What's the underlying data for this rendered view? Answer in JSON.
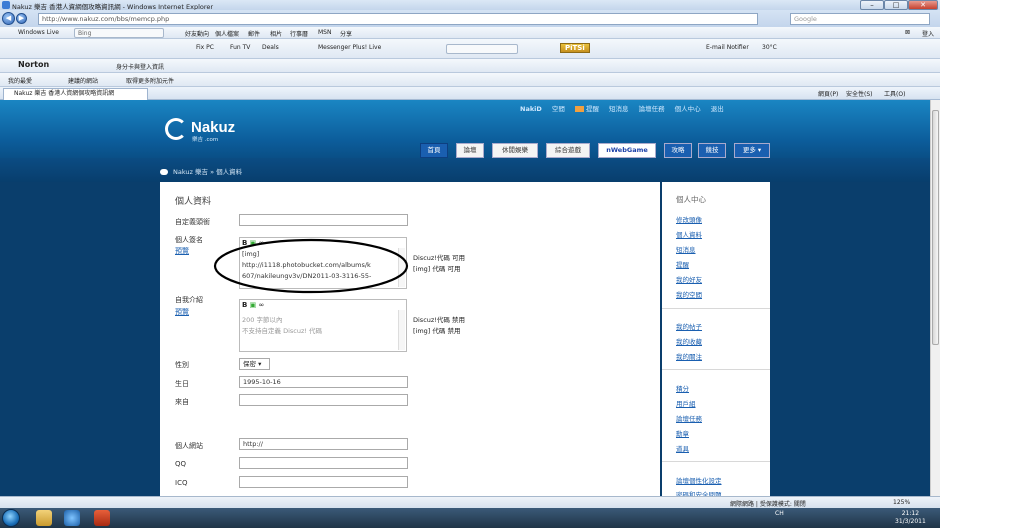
{
  "browser": {
    "title": "Nakuz 樂吉 香港人資網個攻略資訊網 - Windows Internet Explorer",
    "address": "http://www.nakuz.com/bbs/memcp.php",
    "search_provider": "Google",
    "windows_live": "Windows Live",
    "bing": "Bing",
    "toolbar1_items": [
      "好友動向",
      "個人檔案",
      "郵件",
      "相片",
      "行事曆",
      "MSN",
      "分享"
    ],
    "toolbar2_items": [
      "Fix PC",
      "Fun TV",
      "Deals",
      "Messenger Plus! Live"
    ],
    "pitsi": "PiTSi",
    "email_notifier": "E-mail Notifier",
    "temperature": "30°C",
    "norton": "Norton",
    "identity_safe": "身分卡與登入資訊",
    "favorites": "我的最愛",
    "suggested_sites": "建議的網站",
    "more_addons": "取得更多附加元件",
    "tab_title": "Nakuz 樂吉 香港人資網個攻略資訊網",
    "cmd_page": "網頁(P)",
    "cmd_safety": "安全性(S)",
    "cmd_tools": "工具(O)",
    "login": "登入"
  },
  "site": {
    "logo_name": "Nakuz",
    "logo_sub": "樂吉 .com",
    "username": "NakiD",
    "top_links": [
      "空間",
      "提醒",
      "短消息",
      "論壇任務",
      "個人中心",
      "退出"
    ],
    "nav": [
      "首頁",
      "論壇",
      "休閒娛樂",
      "綜合遊戲",
      "nWebGame",
      "攻略",
      "競技",
      "更多"
    ],
    "breadcrumb": "Nakuz 樂吉 » 個人資料"
  },
  "form": {
    "heading": "個人資料",
    "custom_title_label": "自定義頭銜",
    "signature_label": "個人簽名",
    "preview": "預覽",
    "signature_text": [
      "[img]",
      "http://i1118.photobucket.com/albums/k",
      "607/nakileungv3v/DN2011-03-3116-55-"
    ],
    "signature_note": [
      "Discuz!代碼 可用",
      "[img] 代碼 可用"
    ],
    "bio_label": "自我介紹",
    "bio_placeholder": [
      "200 字節以內",
      "不支持自定義 Discuz! 代碼"
    ],
    "bio_note": [
      "Discuz!代碼 禁用",
      "[img] 代碼 禁用"
    ],
    "gender_label": "性別",
    "gender_value": "保密",
    "birthday_label": "生日",
    "birthday_value": "1995-10-16",
    "from_label": "來自",
    "from_value": "",
    "website_label": "個人網站",
    "website_value": "http://",
    "qq_label": "QQ",
    "icq_label": "ICQ"
  },
  "sidebar": {
    "title": "個人中心",
    "group1": [
      "修改頭像",
      "個人資料",
      "短消息",
      "提醒",
      "我的好友",
      "我的空間"
    ],
    "group2": [
      "我的帖子",
      "我的收藏",
      "我的關注"
    ],
    "group3": [
      "積分",
      "用戶組",
      "論壇任務",
      "勳章",
      "道具"
    ],
    "group4": [
      "論壇個性化設定",
      "密碼和安全問題"
    ]
  },
  "status": {
    "zone": "網際網路 | 受保護模式: 關閉",
    "zoom": "125%"
  },
  "taskbar": {
    "lang": "CH",
    "time": "21:12",
    "date": "31/3/2011"
  }
}
